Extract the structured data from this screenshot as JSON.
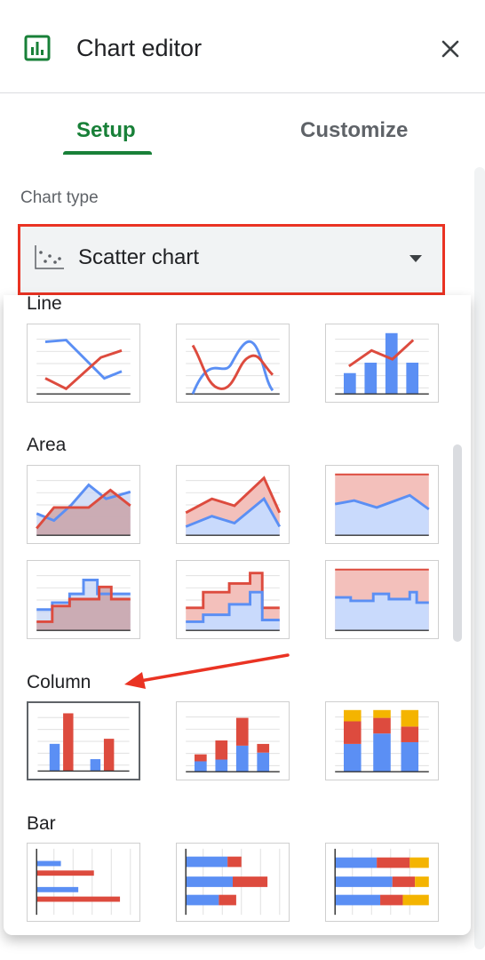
{
  "header": {
    "title": "Chart editor",
    "app_icon": "insert-chart-icon",
    "close_icon": "close-icon"
  },
  "tabs": [
    {
      "label": "Setup",
      "active": true
    },
    {
      "label": "Customize",
      "active": false
    }
  ],
  "chart_type": {
    "section_label": "Chart type",
    "selected": "Scatter chart",
    "icon": "scatter-chart-icon"
  },
  "categories": [
    {
      "label": "Line",
      "options": [
        "line-chart",
        "smooth-line-chart",
        "combo-chart"
      ]
    },
    {
      "label": "Area",
      "options": [
        "area-chart",
        "stacked-area-chart",
        "100-percent-stacked-area-chart",
        "stepped-area-chart",
        "stacked-stepped-area-chart",
        "100-percent-stacked-stepped-area-chart"
      ]
    },
    {
      "label": "Column",
      "options": [
        "column-chart",
        "stacked-column-chart",
        "100-percent-stacked-column-chart"
      ]
    },
    {
      "label": "Bar",
      "options": [
        "bar-chart",
        "stacked-bar-chart",
        "100-percent-stacked-bar-chart"
      ]
    }
  ],
  "colors": {
    "accent_green": "#188038",
    "highlight_red": "#ea3323",
    "chart_blue": "#5b8ff4",
    "chart_red": "#dd4b3e",
    "chart_yellow": "#f4b400"
  }
}
